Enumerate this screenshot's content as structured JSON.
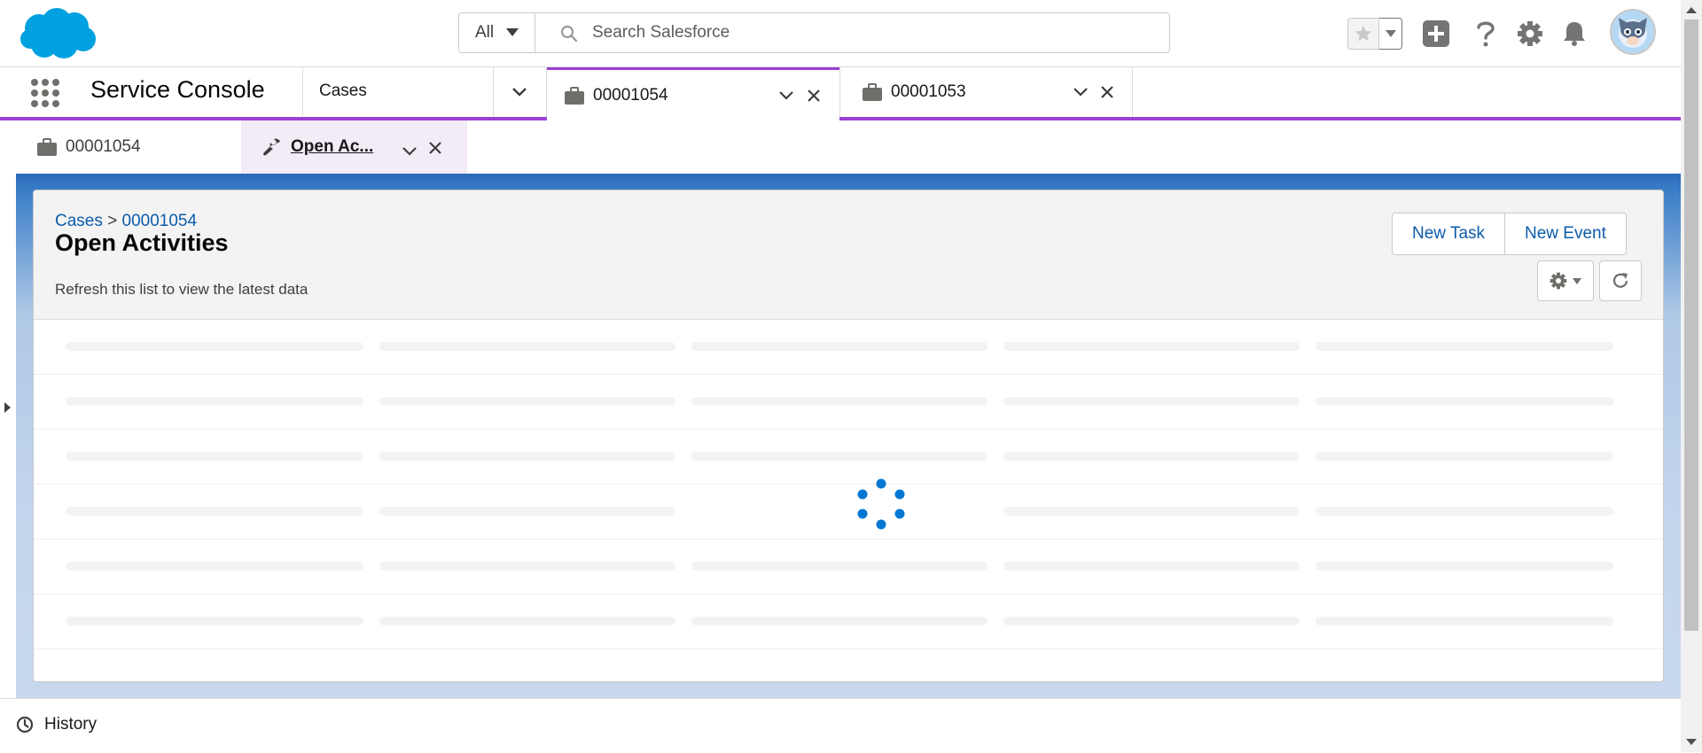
{
  "header": {
    "search_scope": "All",
    "search_placeholder": "Search Salesforce"
  },
  "nav": {
    "app_name": "Service Console",
    "object_tab": "Cases",
    "workspace_tabs": [
      {
        "label": "00001054",
        "active": true
      },
      {
        "label": "00001053",
        "active": false
      }
    ]
  },
  "subtabs": [
    {
      "label": "00001054",
      "active": false
    },
    {
      "label": "Open Ac...",
      "active": true
    }
  ],
  "page": {
    "breadcrumb_parent": "Cases",
    "breadcrumb_separator": ">",
    "breadcrumb_record": "00001054",
    "title": "Open Activities",
    "status_text": "Refresh this list to view the latest data",
    "buttons": {
      "new_task": "New Task",
      "new_event": "New Event"
    },
    "loading": true
  },
  "utility": {
    "history_label": "History"
  },
  "colors": {
    "brand_blue": "#00a1e0",
    "nav_accent": "#9b3fd5",
    "link_blue": "#0b5cab",
    "spinner_blue": "#0176d3"
  }
}
